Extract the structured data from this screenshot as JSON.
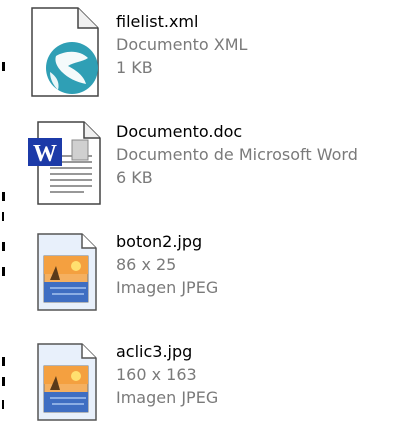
{
  "files": [
    {
      "name": "filelist.xml",
      "line2": "Documento XML",
      "line3": "1 KB",
      "icon": "xml-file-icon"
    },
    {
      "name": "Documento.doc",
      "line2": "Documento de Microsoft Word",
      "line3": "6 KB",
      "icon": "word-document-icon"
    },
    {
      "name": "boton2.jpg",
      "line2": "86 x 25",
      "line3": "Imagen JPEG",
      "icon": "jpeg-image-icon"
    },
    {
      "name": "aclic3.jpg",
      "line2": "160 x 163",
      "line3": "Imagen JPEG",
      "icon": "jpeg-image-icon"
    }
  ],
  "colors": {
    "secondary_text": "#7a7a7a",
    "xml_globe": "#2f9fb5",
    "word_blue": "#1c3aa8"
  }
}
